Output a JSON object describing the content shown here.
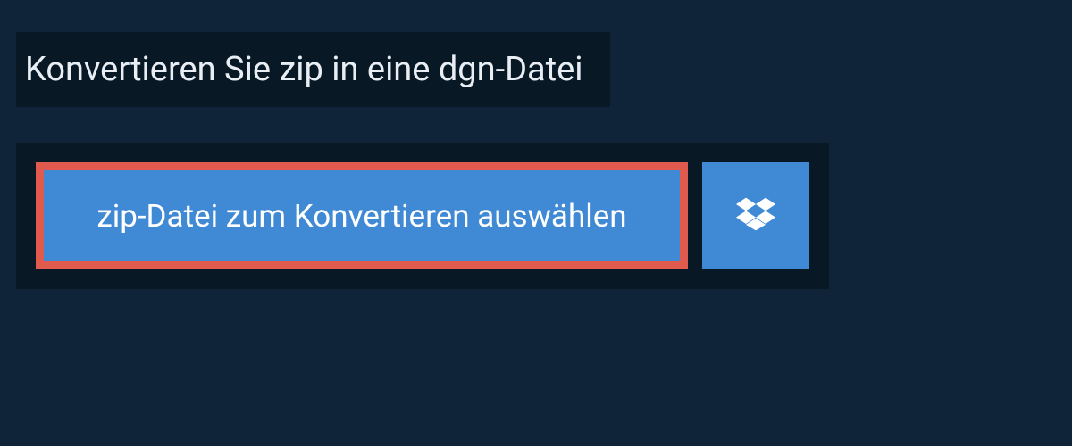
{
  "heading": "Konvertieren Sie zip in eine dgn-Datei",
  "select_button_label": "zip-Datei zum Konvertieren auswählen"
}
